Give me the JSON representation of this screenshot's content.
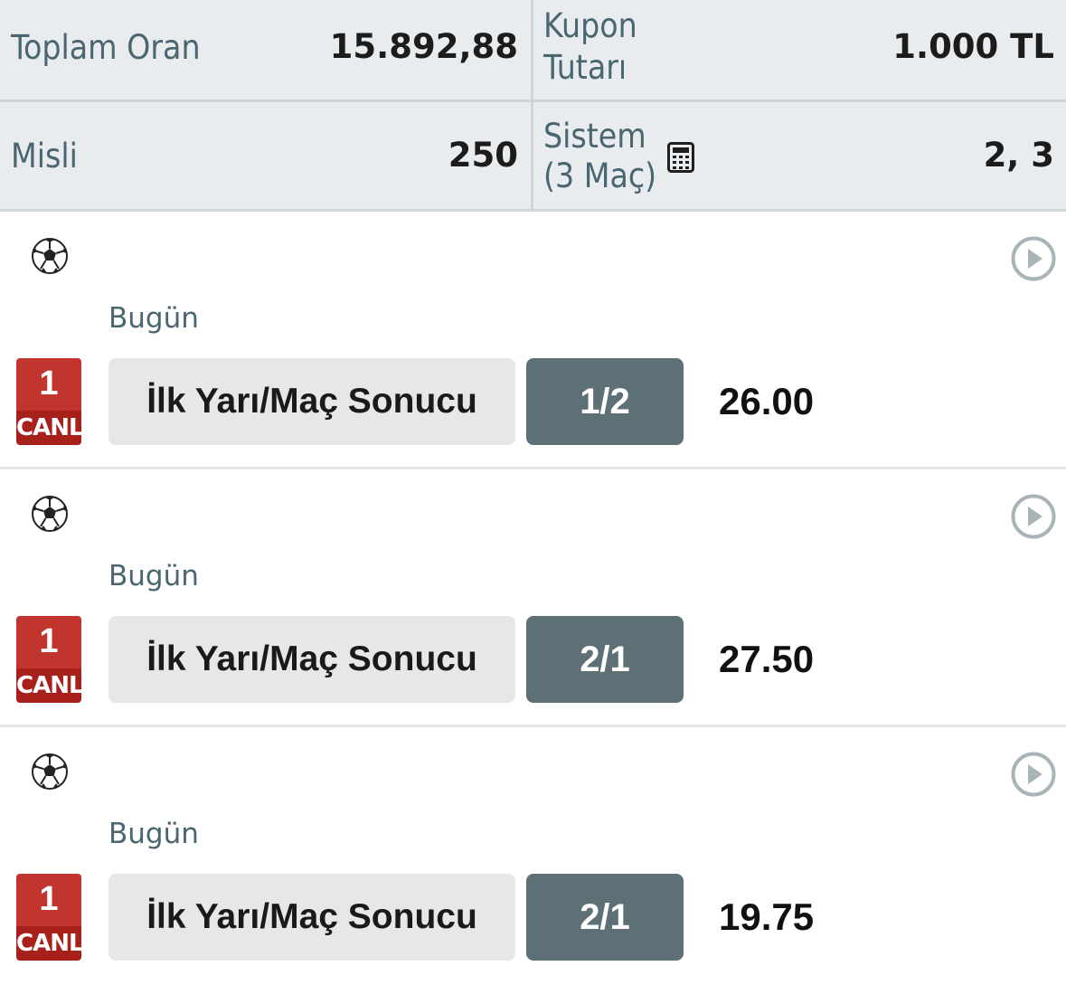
{
  "summary": {
    "total_odds_label": "Toplam Oran",
    "total_odds_value": "15.892,88",
    "coupon_amount_label_line1": "Kupon",
    "coupon_amount_label_line2": "Tutarı",
    "coupon_amount_value": "1.000 TL",
    "multiplier_label": "Misli",
    "multiplier_value": "250",
    "system_label_line1": "Sistem",
    "system_label_line2": "(3 Maç)",
    "system_value": "2, 3",
    "calculator_icon": "calculator-icon"
  },
  "matches": [
    {
      "sport_icon": "soccer-ball-icon",
      "date": "Bugün",
      "live_number": "1",
      "live_label": "CANLI",
      "market": "İlk Yarı/Maç Sonucu",
      "pick": "1/2",
      "odd": "26.00"
    },
    {
      "sport_icon": "soccer-ball-icon",
      "date": "Bugün",
      "live_number": "1",
      "live_label": "CANLI",
      "market": "İlk Yarı/Maç Sonucu",
      "pick": "2/1",
      "odd": "27.50"
    },
    {
      "sport_icon": "soccer-ball-icon",
      "date": "Bugün",
      "live_number": "1",
      "live_label": "CANLI",
      "market": "İlk Yarı/Maç Sonucu",
      "pick": "2/1",
      "odd": "19.75"
    }
  ],
  "colors": {
    "summary_bg": "#e8ecee",
    "label_text": "#4a6670",
    "live_red": "#c2352f",
    "pick_bg": "#5d7076",
    "market_bg": "#e7e7e7"
  }
}
